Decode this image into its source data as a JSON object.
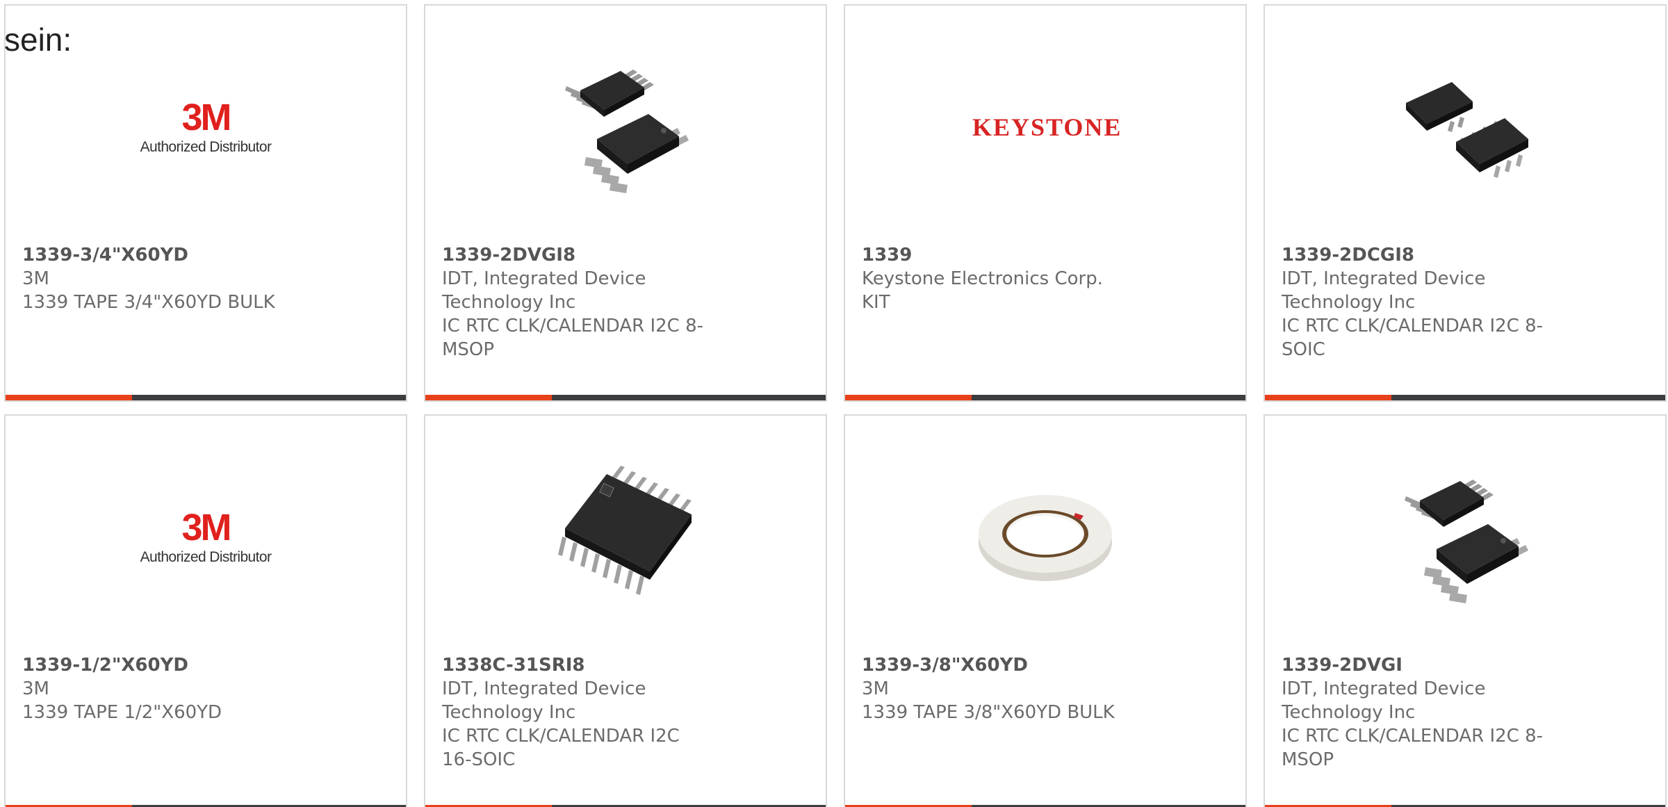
{
  "header": {
    "text": "sein:"
  },
  "products": [
    {
      "part_number": "1339-3/4\"X60YD",
      "manufacturer": "3M",
      "description": "1339 TAPE 3/4\"X60YD BULK",
      "image": "3m-authorized-distributor-logo",
      "logo_text": "3M",
      "logo_subtext": "Authorized Distributor"
    },
    {
      "part_number": "1339-2DVGI8",
      "manufacturer": "IDT, Integrated Device Technology Inc",
      "description": "IC RTC CLK/CALENDAR I2C 8-MSOP",
      "image": "msop-8-chip-photo"
    },
    {
      "part_number": "1339",
      "manufacturer": "Keystone Electronics Corp.",
      "description": "KIT",
      "image": "keystone-logo",
      "logo_text": "KEYSTONE"
    },
    {
      "part_number": "1339-2DCGI8",
      "manufacturer": "IDT, Integrated Device Technology Inc",
      "description": "IC RTC CLK/CALENDAR I2C 8-SOIC",
      "image": "soic-8-chip-photo"
    },
    {
      "part_number": "1339-1/2\"X60YD",
      "manufacturer": "3M",
      "description": "1339 TAPE 1/2\"X60YD",
      "image": "3m-authorized-distributor-logo",
      "logo_text": "3M",
      "logo_subtext": "Authorized Distributor"
    },
    {
      "part_number": "1338C-31SRI8",
      "manufacturer": "IDT, Integrated Device Technology Inc",
      "description": "IC RTC CLK/CALENDAR I2C 16-SOIC",
      "image": "soic-16-chip-photo"
    },
    {
      "part_number": "1339-3/8\"X60YD",
      "manufacturer": "3M",
      "description": "1339 TAPE 3/8\"X60YD BULK",
      "image": "tape-roll-photo"
    },
    {
      "part_number": "1339-2DVGI",
      "manufacturer": "IDT, Integrated Device Technology Inc",
      "description": "IC RTC CLK/CALENDAR I2C 8-MSOP",
      "image": "msop-8-chip-photo"
    }
  ],
  "colors": {
    "accent_bar": "#e8411a",
    "dark_bar": "#3b3d3f",
    "logo_red": "#e0201d",
    "card_border": "#d8d8d8"
  }
}
